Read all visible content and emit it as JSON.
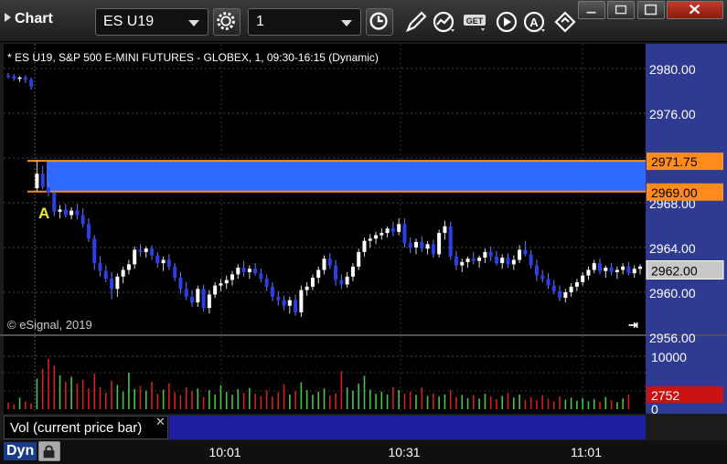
{
  "toolbar": {
    "app_menu": "Chart",
    "symbol": "ES U19",
    "interval": "1"
  },
  "chart_title": "* ES U19, S&P 500 E-MINI FUTURES - GLOBEX, 1, 09:30-16:15 (Dynamic)",
  "copyright": "© eSignal, 2019",
  "marker_label": "A",
  "colors": {
    "up": "#ffffff",
    "down": "#2b3fe8",
    "zone": "#2f6aff",
    "zone_line": "#ff8c1a",
    "axis_bg": "#2f3b93",
    "vol_up": "#49c44a",
    "vol_down": "#d22020",
    "last_price": "#c8c8c8",
    "last_vol": "#cc1111"
  },
  "chart_data": [
    {
      "type": "candlestick",
      "symbol": "ES U19",
      "y_ticks": [
        "2980.00",
        "2976.00",
        "2972.00",
        "2968.00",
        "2964.00",
        "2960.00",
        "2956.00"
      ],
      "ylim": [
        2956,
        2982
      ],
      "zone": {
        "upper": 2971.75,
        "lower": 2969.0,
        "upper_label": "2971.75",
        "lower_label": "2969.00"
      },
      "last_price_label": "2962.00",
      "x_tick_labels": [
        "10:01",
        "10:31",
        "11:01"
      ],
      "bars": [
        [
          2979.4,
          2979.6,
          2979.1,
          2979.3
        ],
        [
          2979.3,
          2979.5,
          2978.9,
          2979.1
        ],
        [
          2979.1,
          2979.3,
          2978.8,
          2979.2
        ],
        [
          2979.2,
          2979.4,
          2978.7,
          2979.0
        ],
        [
          2979.0,
          2979.2,
          2978.1,
          2978.4
        ],
        [
          2969.3,
          2971.8,
          2969.0,
          2970.6
        ],
        [
          2970.6,
          2971.3,
          2969.2,
          2969.4
        ],
        [
          2969.4,
          2969.8,
          2968.6,
          2968.9
        ],
        [
          2968.9,
          2969.2,
          2966.8,
          2967.2
        ],
        [
          2967.2,
          2967.8,
          2966.6,
          2967.4
        ],
        [
          2967.4,
          2967.9,
          2966.7,
          2966.9
        ],
        [
          2966.9,
          2967.6,
          2966.5,
          2967.3
        ],
        [
          2967.3,
          2967.9,
          2966.5,
          2966.9
        ],
        [
          2966.9,
          2967.5,
          2965.8,
          2966.1
        ],
        [
          2966.1,
          2966.6,
          2964.5,
          2964.8
        ],
        [
          2964.8,
          2965.1,
          2962.0,
          2962.6
        ],
        [
          2962.6,
          2963.2,
          2961.4,
          2961.9
        ],
        [
          2961.9,
          2962.4,
          2960.9,
          2961.2
        ],
        [
          2961.2,
          2961.8,
          2959.4,
          2960.3
        ],
        [
          2960.3,
          2961.7,
          2959.6,
          2961.4
        ],
        [
          2961.4,
          2962.3,
          2960.8,
          2962.0
        ],
        [
          2962.0,
          2962.9,
          2961.6,
          2962.5
        ],
        [
          2962.5,
          2964.1,
          2962.1,
          2963.8
        ],
        [
          2963.8,
          2964.3,
          2963.2,
          2963.6
        ],
        [
          2963.6,
          2964.1,
          2963.1,
          2963.9
        ],
        [
          2963.9,
          2964.2,
          2962.9,
          2963.3
        ],
        [
          2963.3,
          2963.6,
          2962.2,
          2962.6
        ],
        [
          2962.6,
          2963.2,
          2961.9,
          2962.9
        ],
        [
          2962.9,
          2963.4,
          2962.0,
          2962.3
        ],
        [
          2962.3,
          2962.6,
          2961.0,
          2961.3
        ],
        [
          2961.3,
          2961.8,
          2959.9,
          2960.3
        ],
        [
          2960.3,
          2960.9,
          2959.3,
          2959.6
        ],
        [
          2959.6,
          2960.2,
          2958.7,
          2959.1
        ],
        [
          2959.1,
          2960.6,
          2958.7,
          2960.3
        ],
        [
          2960.3,
          2960.7,
          2958.3,
          2958.6
        ],
        [
          2958.6,
          2960.2,
          2958.1,
          2959.8
        ],
        [
          2959.8,
          2960.9,
          2959.5,
          2960.6
        ],
        [
          2960.6,
          2961.2,
          2960.1,
          2960.8
        ],
        [
          2960.8,
          2961.5,
          2960.3,
          2961.1
        ],
        [
          2961.1,
          2961.9,
          2960.6,
          2961.6
        ],
        [
          2961.6,
          2962.5,
          2961.2,
          2962.2
        ],
        [
          2962.2,
          2962.8,
          2961.4,
          2961.8
        ],
        [
          2961.8,
          2962.4,
          2961.2,
          2962.1
        ],
        [
          2962.1,
          2962.6,
          2961.5,
          2961.7
        ],
        [
          2961.7,
          2962.1,
          2960.9,
          2961.2
        ],
        [
          2961.2,
          2961.6,
          2960.1,
          2960.5
        ],
        [
          2960.5,
          2960.9,
          2959.2,
          2959.6
        ],
        [
          2959.6,
          2960.1,
          2958.8,
          2959.3
        ],
        [
          2959.3,
          2959.7,
          2958.4,
          2958.8
        ],
        [
          2958.8,
          2959.6,
          2958.1,
          2959.3
        ],
        [
          2959.3,
          2959.8,
          2957.9,
          2958.2
        ],
        [
          2958.2,
          2960.6,
          2957.8,
          2960.2
        ],
        [
          2960.2,
          2960.9,
          2959.7,
          2960.5
        ],
        [
          2960.5,
          2961.6,
          2960.2,
          2961.3
        ],
        [
          2961.3,
          2962.3,
          2960.8,
          2962.0
        ],
        [
          2962.0,
          2963.3,
          2961.6,
          2963.0
        ],
        [
          2963.0,
          2963.5,
          2962.1,
          2962.4
        ],
        [
          2962.4,
          2962.9,
          2960.6,
          2961.1
        ],
        [
          2961.1,
          2961.6,
          2960.3,
          2960.7
        ],
        [
          2960.7,
          2961.8,
          2960.4,
          2961.4
        ],
        [
          2961.4,
          2962.6,
          2961.0,
          2962.3
        ],
        [
          2962.3,
          2963.9,
          2962.0,
          2963.6
        ],
        [
          2963.6,
          2964.9,
          2963.2,
          2964.6
        ],
        [
          2964.6,
          2965.2,
          2964.0,
          2964.8
        ],
        [
          2964.8,
          2965.4,
          2964.3,
          2965.1
        ],
        [
          2965.1,
          2965.7,
          2964.7,
          2965.3
        ],
        [
          2965.3,
          2965.9,
          2964.9,
          2965.7
        ],
        [
          2965.7,
          2966.3,
          2965.0,
          2965.4
        ],
        [
          2965.4,
          2966.6,
          2965.1,
          2966.1
        ],
        [
          2966.1,
          2966.6,
          2964.0,
          2964.4
        ],
        [
          2964.4,
          2964.9,
          2963.5,
          2964.0
        ],
        [
          2964.0,
          2964.8,
          2963.4,
          2964.5
        ],
        [
          2964.5,
          2965.0,
          2963.6,
          2963.9
        ],
        [
          2963.9,
          2964.6,
          2963.4,
          2964.3
        ],
        [
          2964.3,
          2964.7,
          2963.1,
          2963.4
        ],
        [
          2963.4,
          2965.6,
          2963.1,
          2965.3
        ],
        [
          2965.3,
          2966.4,
          2964.7,
          2965.9
        ],
        [
          2965.9,
          2966.3,
          2962.9,
          2963.2
        ],
        [
          2963.2,
          2963.7,
          2962.0,
          2962.4
        ],
        [
          2962.4,
          2963.0,
          2961.8,
          2962.7
        ],
        [
          2962.7,
          2963.2,
          2962.2,
          2963.0
        ],
        [
          2963.0,
          2963.6,
          2962.5,
          2962.8
        ],
        [
          2962.8,
          2963.3,
          2962.2,
          2963.1
        ],
        [
          2963.1,
          2963.9,
          2962.6,
          2963.6
        ],
        [
          2963.6,
          2964.1,
          2962.8,
          2963.2
        ],
        [
          2963.2,
          2963.7,
          2962.4,
          2962.6
        ],
        [
          2962.6,
          2963.4,
          2962.1,
          2963.1
        ],
        [
          2963.1,
          2963.5,
          2962.2,
          2962.5
        ],
        [
          2962.5,
          2963.3,
          2962.0,
          2962.9
        ],
        [
          2962.9,
          2964.2,
          2962.6,
          2963.8
        ],
        [
          2963.8,
          2964.6,
          2963.2,
          2963.4
        ],
        [
          2963.4,
          2963.8,
          2962.1,
          2962.4
        ],
        [
          2962.4,
          2962.9,
          2961.0,
          2961.5
        ],
        [
          2961.5,
          2962.0,
          2960.9,
          2961.2
        ],
        [
          2961.2,
          2961.7,
          2960.3,
          2960.6
        ],
        [
          2960.6,
          2961.1,
          2959.8,
          2960.1
        ],
        [
          2960.1,
          2960.6,
          2959.2,
          2959.5
        ],
        [
          2959.5,
          2960.3,
          2959.1,
          2960.0
        ],
        [
          2960.0,
          2960.8,
          2959.6,
          2960.5
        ],
        [
          2960.5,
          2961.2,
          2960.1,
          2960.9
        ],
        [
          2960.9,
          2961.8,
          2960.6,
          2961.5
        ],
        [
          2961.5,
          2962.3,
          2961.1,
          2962.0
        ],
        [
          2962.0,
          2962.9,
          2961.7,
          2962.6
        ],
        [
          2962.6,
          2963.0,
          2961.6,
          2961.9
        ],
        [
          2961.9,
          2962.4,
          2961.3,
          2962.2
        ],
        [
          2962.2,
          2962.6,
          2961.5,
          2961.8
        ],
        [
          2961.8,
          2962.3,
          2961.2,
          2962.0
        ],
        [
          2962.0,
          2962.6,
          2961.6,
          2962.3
        ],
        [
          2962.3,
          2962.7,
          2961.5,
          2961.7
        ],
        [
          2961.7,
          2962.4,
          2961.3,
          2962.1
        ],
        [
          2962.1,
          2962.5,
          2961.6,
          2962.3
        ]
      ]
    },
    {
      "type": "bar",
      "title": "Vol (current price bar)",
      "y_ticks": [
        "10000",
        "0"
      ],
      "ylim": [
        0,
        13000
      ],
      "last_value_label": "2752",
      "values": [
        1200,
        900,
        2200,
        1500,
        1100,
        5800,
        7600,
        9500,
        8200,
        6400,
        5200,
        6100,
        4800,
        5600,
        3900,
        6700,
        4200,
        3100,
        5400,
        4600,
        3300,
        6900,
        3800,
        4400,
        3500,
        5200,
        2900,
        3700,
        4900,
        3200,
        2600,
        4100,
        3400,
        3900,
        2300,
        3600,
        2800,
        4500,
        3300,
        2700,
        3800,
        3100,
        4000,
        2900,
        2500,
        3500,
        2400,
        3200,
        4700,
        2800,
        3400,
        5100,
        3600,
        2700,
        3300,
        3900,
        2600,
        3000,
        7200,
        4100,
        3500,
        4800,
        6300,
        3700,
        2900,
        3300,
        2800,
        4200,
        3600,
        2900,
        3300,
        2700,
        4100,
        2500,
        3000,
        2400,
        2800,
        3600,
        2300,
        2700,
        2100,
        2600,
        2000,
        2900,
        2400,
        1900,
        2500,
        3100,
        2200,
        2800,
        1800,
        2300,
        1700,
        2600,
        2000,
        1500,
        2400,
        1800,
        2200,
        1600,
        2100,
        1500,
        1900,
        1400,
        2300,
        1700,
        1300,
        2000,
        2752
      ]
    }
  ]
}
